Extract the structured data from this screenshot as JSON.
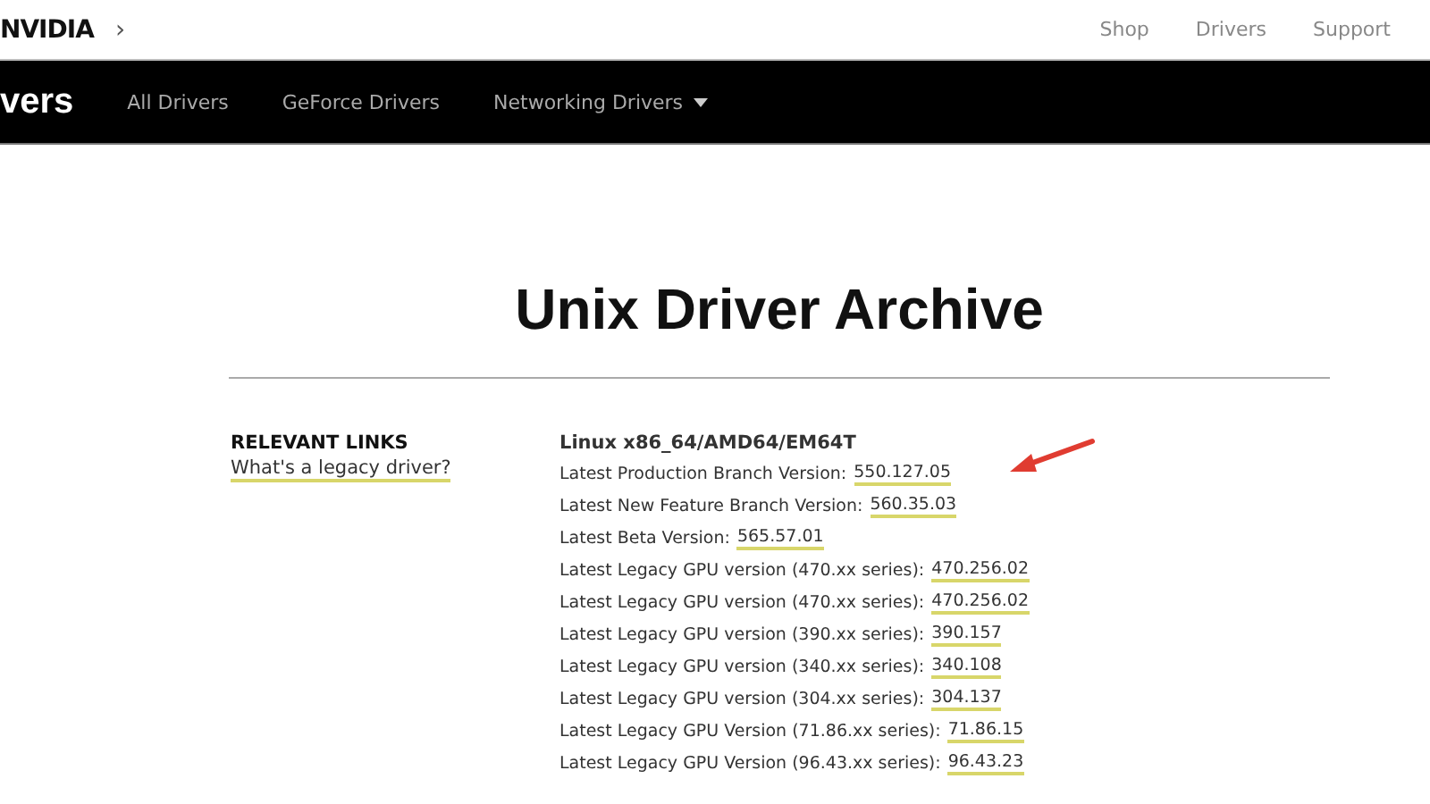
{
  "top_bar": {
    "logo": "NVIDIA",
    "breadcrumb_icon": "›",
    "links": [
      "Shop",
      "Drivers",
      "Support"
    ]
  },
  "nav": {
    "title": "vers",
    "items": [
      {
        "label": "All Drivers",
        "dropdown": false
      },
      {
        "label": "GeForce Drivers",
        "dropdown": false
      },
      {
        "label": "Networking Drivers",
        "dropdown": true
      }
    ]
  },
  "page_title": "Unix Driver Archive",
  "sidebar": {
    "heading": "RELEVANT LINKS",
    "links": [
      "What's a legacy driver?"
    ]
  },
  "section": {
    "heading": "Linux x86_64/AMD64/EM64T",
    "rows": [
      {
        "label": "Latest Production Branch Version:",
        "version": "550.127.05",
        "highlighted": true
      },
      {
        "label": "Latest New Feature Branch Version:",
        "version": "560.35.03",
        "highlighted": false
      },
      {
        "label": "Latest Beta Version:",
        "version": "565.57.01",
        "highlighted": false
      },
      {
        "label": "Latest Legacy GPU version (470.xx series):",
        "version": "470.256.02",
        "highlighted": false
      },
      {
        "label": "Latest Legacy GPU version (470.xx series):",
        "version": "470.256.02",
        "highlighted": false
      },
      {
        "label": "Latest Legacy GPU version (390.xx series):",
        "version": "390.157",
        "highlighted": false
      },
      {
        "label": "Latest Legacy GPU version (340.xx series):",
        "version": "340.108",
        "highlighted": false
      },
      {
        "label": "Latest Legacy GPU version (304.xx series):",
        "version": "304.137",
        "highlighted": false
      },
      {
        "label": "Latest Legacy GPU Version (71.86.xx series):",
        "version": "71.86.15",
        "highlighted": false
      },
      {
        "label": "Latest Legacy GPU Version (96.43.xx series):",
        "version": "96.43.23",
        "highlighted": false
      }
    ]
  }
}
